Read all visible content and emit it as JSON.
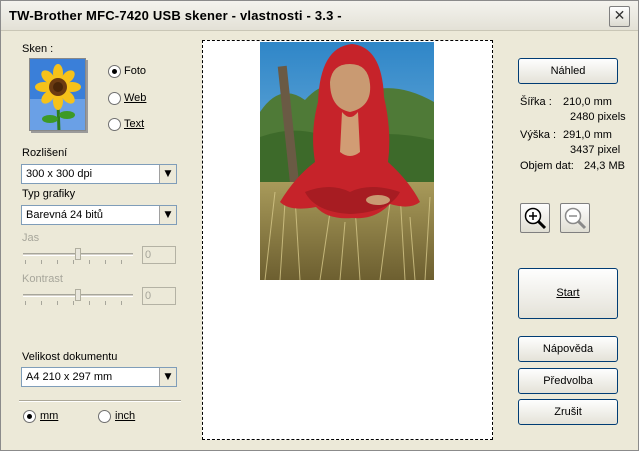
{
  "window": {
    "title": "TW-Brother MFC-7420 USB skener - vlastnosti - 3.3 -",
    "close_glyph": "✕"
  },
  "scan": {
    "label": "Sken :",
    "options": [
      {
        "label": "Foto",
        "selected": true
      },
      {
        "label": "Web",
        "selected": false
      },
      {
        "label": "Text",
        "selected": false
      }
    ]
  },
  "resolution": {
    "label": "Rozlišení",
    "value": "300 x 300 dpi"
  },
  "graphics_type": {
    "label": "Typ grafiky",
    "value": "Barevná 24 bitů"
  },
  "brightness": {
    "label": "Jas",
    "value": "0",
    "level": 0.5,
    "enabled": false
  },
  "contrast": {
    "label": "Kontrast",
    "value": "0",
    "level": 0.5,
    "enabled": false
  },
  "document_size": {
    "label": "Velikost dokumentu",
    "value": "A4 210 x 297 mm"
  },
  "units": [
    {
      "label": "mm",
      "selected": true
    },
    {
      "label": "inch",
      "selected": false
    }
  ],
  "buttons": {
    "preview": "Náhled",
    "start": "Start",
    "help": "Nápověda",
    "preset": "Předvolba",
    "cancel": "Zrušit"
  },
  "info": {
    "width_label": "Šířka :",
    "width_mm": "210,0 mm",
    "width_px": "2480 pixels",
    "height_label": "Výška :",
    "height_mm": "291,0 mm",
    "height_px": "3437 pixel",
    "size_label": "Objem dat:",
    "size_value": "24,3 MB"
  },
  "icons": {
    "zoom_in": "zoom-in-icon",
    "zoom_out": "zoom-out-icon",
    "thumbnail": "sunflower-photo-icon",
    "close": "close-icon"
  },
  "colors": {
    "accent": "#003c74",
    "dialog_bg": "#ece9d8",
    "disabled_text": "#a7a69b"
  }
}
